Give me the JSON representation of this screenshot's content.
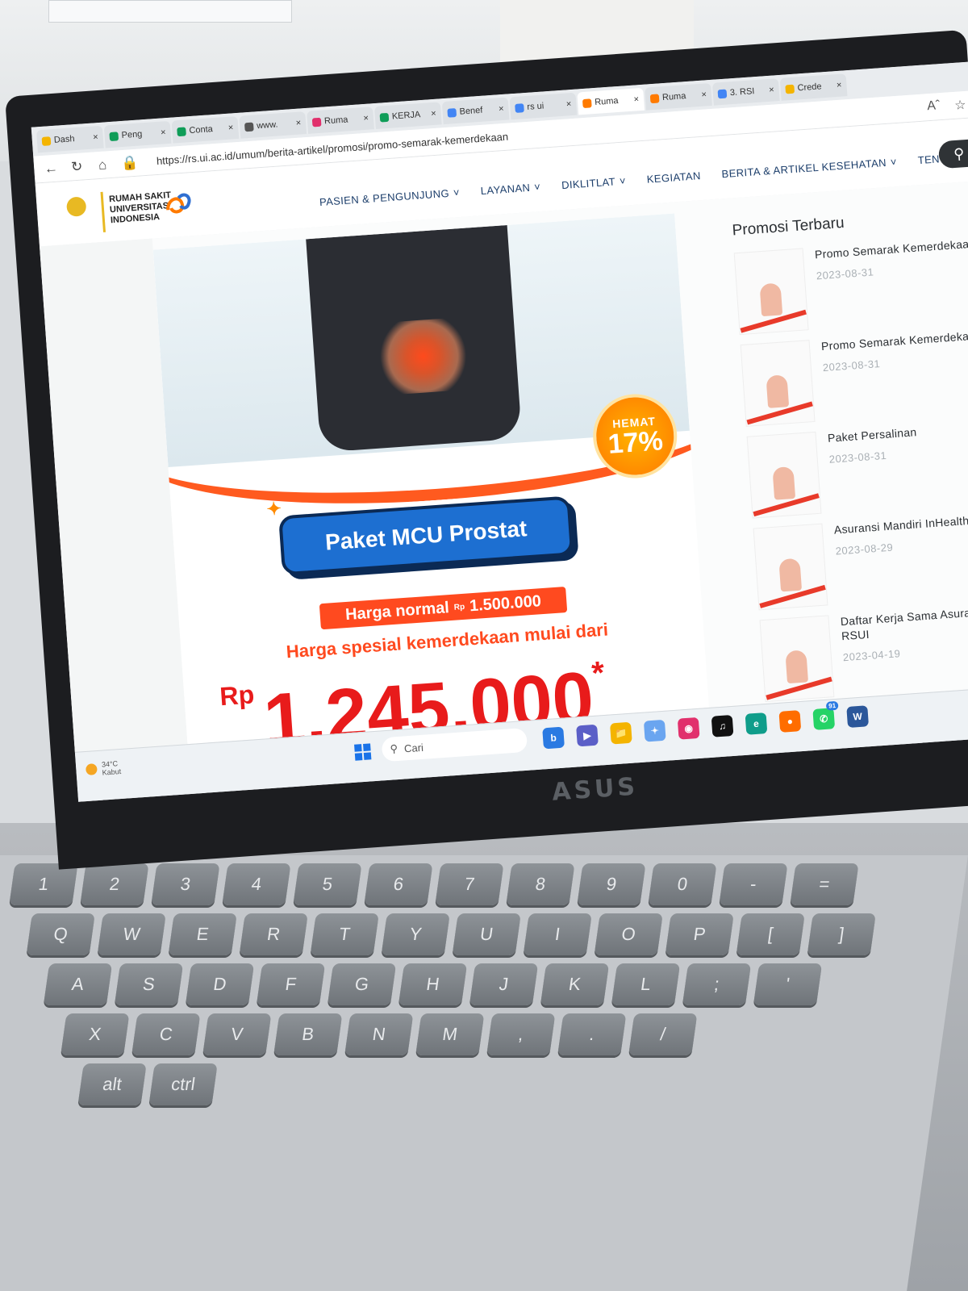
{
  "browser": {
    "tabs": [
      {
        "label": "Dash",
        "color": "#f4b400"
      },
      {
        "label": "Peng",
        "color": "#0f9d58"
      },
      {
        "label": "Conta",
        "color": "#0f9d58"
      },
      {
        "label": "www.",
        "color": "#555555"
      },
      {
        "label": "Ruma",
        "color": "#e1306c"
      },
      {
        "label": "KERJA",
        "color": "#0f9d58"
      },
      {
        "label": "Benef",
        "color": "#4285f4"
      },
      {
        "label": "rs ui",
        "color": "#4285f4"
      },
      {
        "label": "Ruma",
        "color": "#ff7a00",
        "active": true
      },
      {
        "label": "Ruma",
        "color": "#ff7a00"
      },
      {
        "label": "3. RSI",
        "color": "#4285f4"
      },
      {
        "label": "Crede",
        "color": "#f4b400"
      }
    ],
    "url": "https://rs.ui.ac.id/umum/berita-artikel/promosi/promo-semarak-kemerdekaan"
  },
  "site": {
    "brand_lines": [
      "RUMAH SAKIT",
      "UNIVERSITAS",
      "INDONESIA"
    ],
    "menu": [
      {
        "label": "PASIEN & PENGUNJUNG",
        "dropdown": true
      },
      {
        "label": "LAYANAN",
        "dropdown": true
      },
      {
        "label": "DIKLITLAT",
        "dropdown": true
      },
      {
        "label": "KEGIATAN",
        "dropdown": false
      },
      {
        "label": "BERITA & ARTIKEL KESEHATAN",
        "dropdown": true
      },
      {
        "label": "TENTA",
        "dropdown": false
      }
    ]
  },
  "banner": {
    "badge_top": "HEMAT",
    "badge_value": "17%",
    "title": "Paket MCU Prostat",
    "normal_label": "Harga normal",
    "normal_currency": "Rp",
    "normal_price": "1.500.000",
    "special_label": "Harga spesial kemerdekaan mulai dari",
    "special_currency": "Rp",
    "special_price": "1.245.000",
    "asterisk": "*"
  },
  "sidebar": {
    "heading": "Promosi Terbaru",
    "items": [
      {
        "title": "Promo Semarak Kemerdekaan",
        "date": "2023-08-31"
      },
      {
        "title": "Promo Semarak Kemerdekaan",
        "date": "2023-08-31"
      },
      {
        "title": "Paket Persalinan",
        "date": "2023-08-31"
      },
      {
        "title": "Asuransi Mandiri InHealth",
        "date": "2023-08-29"
      },
      {
        "title": "Daftar Kerja Sama Asuransi RSUI",
        "date": "2023-04-19"
      }
    ]
  },
  "taskbar": {
    "temperature": "34°C",
    "weather": "Kabut",
    "search_label": "Cari",
    "whatsapp_badge": "91"
  },
  "laptop": {
    "brand": "ASUS"
  },
  "keyboard": {
    "rows": [
      [
        "1",
        "2",
        "3",
        "4",
        "5",
        "6",
        "7",
        "8",
        "9",
        "0",
        "-",
        "="
      ],
      [
        "Q",
        "W",
        "E",
        "R",
        "T",
        "Y",
        "U",
        "I",
        "O",
        "P",
        "[",
        "]"
      ],
      [
        "A",
        "S",
        "D",
        "F",
        "G",
        "H",
        "J",
        "K",
        "L",
        ";",
        "'"
      ],
      [
        "X",
        "C",
        "V",
        "B",
        "N",
        "M",
        ",",
        ".",
        "/"
      ],
      [
        "alt",
        "ctrl"
      ]
    ]
  }
}
